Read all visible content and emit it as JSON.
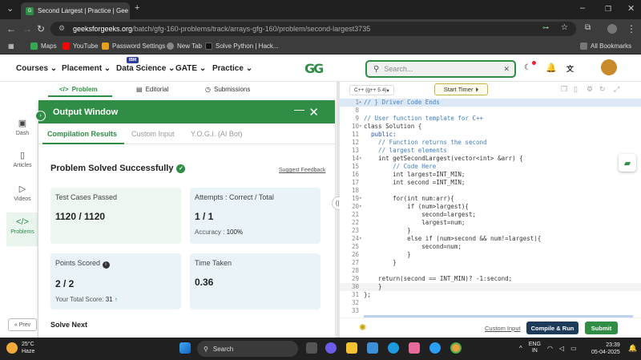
{
  "browser": {
    "tab_title": "Second Largest | Practice | Gee",
    "new_tab_symbol": "+",
    "url_domain": "geeksforgeeks.org",
    "url_path": "/batch/gfg-160-problems/track/arrays-gfg-160/problem/second-largest3735",
    "bookmarks": [
      "Maps",
      "YouTube",
      "Password Settings",
      "New Tab",
      "Solve Python | Hack..."
    ],
    "all_bookmarks": "All Bookmarks"
  },
  "site": {
    "menu": [
      "Courses",
      "Placement",
      "Data Science",
      "GATE",
      "Practice"
    ],
    "ibm_badge": "IBM",
    "logo": "GG",
    "search_placeholder": "Search..."
  },
  "problem_tabs": [
    "Problem",
    "Editorial",
    "Submissions"
  ],
  "sidebar": {
    "items": [
      "Dash",
      "Articles",
      "Videos",
      "Problems"
    ],
    "prev": "« Prev"
  },
  "output": {
    "title": "Output Window",
    "tabs": [
      "Compilation Results",
      "Custom Input",
      "Y.O.G.I. (AI Bot)"
    ],
    "status": "Problem Solved Successfully",
    "feedback": "Suggest Feedback",
    "cards": {
      "test_cases_label": "Test Cases Passed",
      "test_cases_value": "1120 / 1120",
      "attempts_label": "Attempts : Correct / Total",
      "attempts_value": "1 / 1",
      "accuracy_label": "Accuracy :",
      "accuracy_value": "100%",
      "points_label": "Points Scored",
      "points_value": "2 / 2",
      "total_score_label": "Your Total Score:",
      "total_score_value": "31",
      "time_label": "Time Taken",
      "time_value": "0.36"
    },
    "solve_next": "Solve Next"
  },
  "editor": {
    "language": "C++ (g++ 5.4)",
    "timer": "Start Timer",
    "code_lines": [
      {
        "n": "1",
        "t": "// } Driver Code Ends"
      },
      {
        "n": "8",
        "t": ""
      },
      {
        "n": "9",
        "t": "// User function template for C++"
      },
      {
        "n": "10",
        "t": "class Solution {"
      },
      {
        "n": "11",
        "t": "  public:"
      },
      {
        "n": "12",
        "t": "    // Function returns the second"
      },
      {
        "n": "13",
        "t": "    // largest elements"
      },
      {
        "n": "14",
        "t": "    int getSecondLargest(vector<int> &arr) {"
      },
      {
        "n": "15",
        "t": "        // Code Here"
      },
      {
        "n": "16",
        "t": "        int largest=INT_MIN;"
      },
      {
        "n": "17",
        "t": "        int second =INT_MIN;"
      },
      {
        "n": "18",
        "t": ""
      },
      {
        "n": "19",
        "t": "        for(int num:arr){"
      },
      {
        "n": "20",
        "t": "            if (num>largest){"
      },
      {
        "n": "21",
        "t": "                second=largest;"
      },
      {
        "n": "22",
        "t": "                largest=num;"
      },
      {
        "n": "23",
        "t": "            }"
      },
      {
        "n": "24",
        "t": "            else if (num>second && num!=largest){"
      },
      {
        "n": "25",
        "t": "                second=num;"
      },
      {
        "n": "26",
        "t": "            }"
      },
      {
        "n": "27",
        "t": "        }"
      },
      {
        "n": "28",
        "t": ""
      },
      {
        "n": "29",
        "t": "    return(second == INT_MIN)? -1:second;"
      },
      {
        "n": "30",
        "t": "    }"
      },
      {
        "n": "31",
        "t": "};"
      },
      {
        "n": "32",
        "t": ""
      },
      {
        "n": "33",
        "t": ""
      }
    ],
    "custom_input": "Custom Input",
    "compile_run": "Compile & Run",
    "submit": "Submit"
  },
  "taskbar": {
    "temp": "25°C",
    "weather": "Haze",
    "search": "Search",
    "lang1": "ENG",
    "lang2": "IN",
    "time": "23:39",
    "date": "05-04-2025"
  }
}
